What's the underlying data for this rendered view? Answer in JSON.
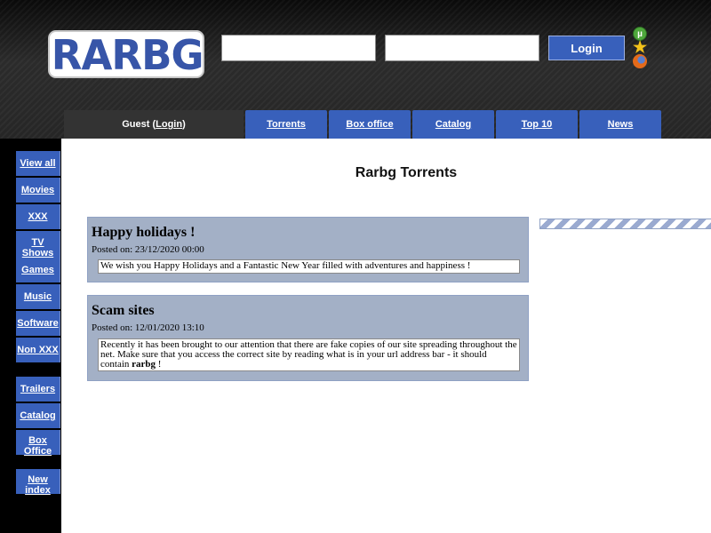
{
  "brand": {
    "logo_text": "RARBG"
  },
  "login": {
    "username_value": "",
    "password_value": "",
    "button_label": "Login"
  },
  "side_icons": [
    "utorrent-icon",
    "star-icon",
    "firefox-icon"
  ],
  "topnav": {
    "guest_prefix": "Guest (",
    "guest_link": "Login",
    "guest_suffix": ")",
    "tabs": [
      "Torrents",
      "Box office",
      "Catalog",
      "Top 10",
      "News"
    ]
  },
  "sidebar": {
    "items": [
      {
        "label": "View all"
      },
      {
        "label": "Movies"
      },
      {
        "label": "XXX"
      },
      {
        "label": "TV Shows"
      },
      {
        "label": "Games"
      },
      {
        "label": "Music"
      },
      {
        "label": "Software"
      },
      {
        "label": "Non XXX"
      },
      {
        "label": "Trailers"
      },
      {
        "label": "Catalog"
      },
      {
        "label": "Box Office"
      },
      {
        "label": "New index"
      }
    ]
  },
  "main": {
    "title": "Rarbg Torrents",
    "news": [
      {
        "title": "Happy holidays !",
        "date": "Posted on: 23/12/2020 00:00",
        "body": "We wish you Happy Holidays and a Fantastic New Year filled with adventures and happiness !"
      },
      {
        "title": "Scam sites",
        "date": "Posted on: 12/01/2020 13:10",
        "body": "Recently it has been brought to our attention that there are fake copies of our site spreading throughout the net. Make sure that you access the correct site by reading what is in your url address bar - it should contain",
        "body_bold": "rarbg",
        "body_end": " !"
      }
    ]
  },
  "colors": {
    "accent": "#3860bb",
    "news_bg": "#a3b0c6"
  }
}
